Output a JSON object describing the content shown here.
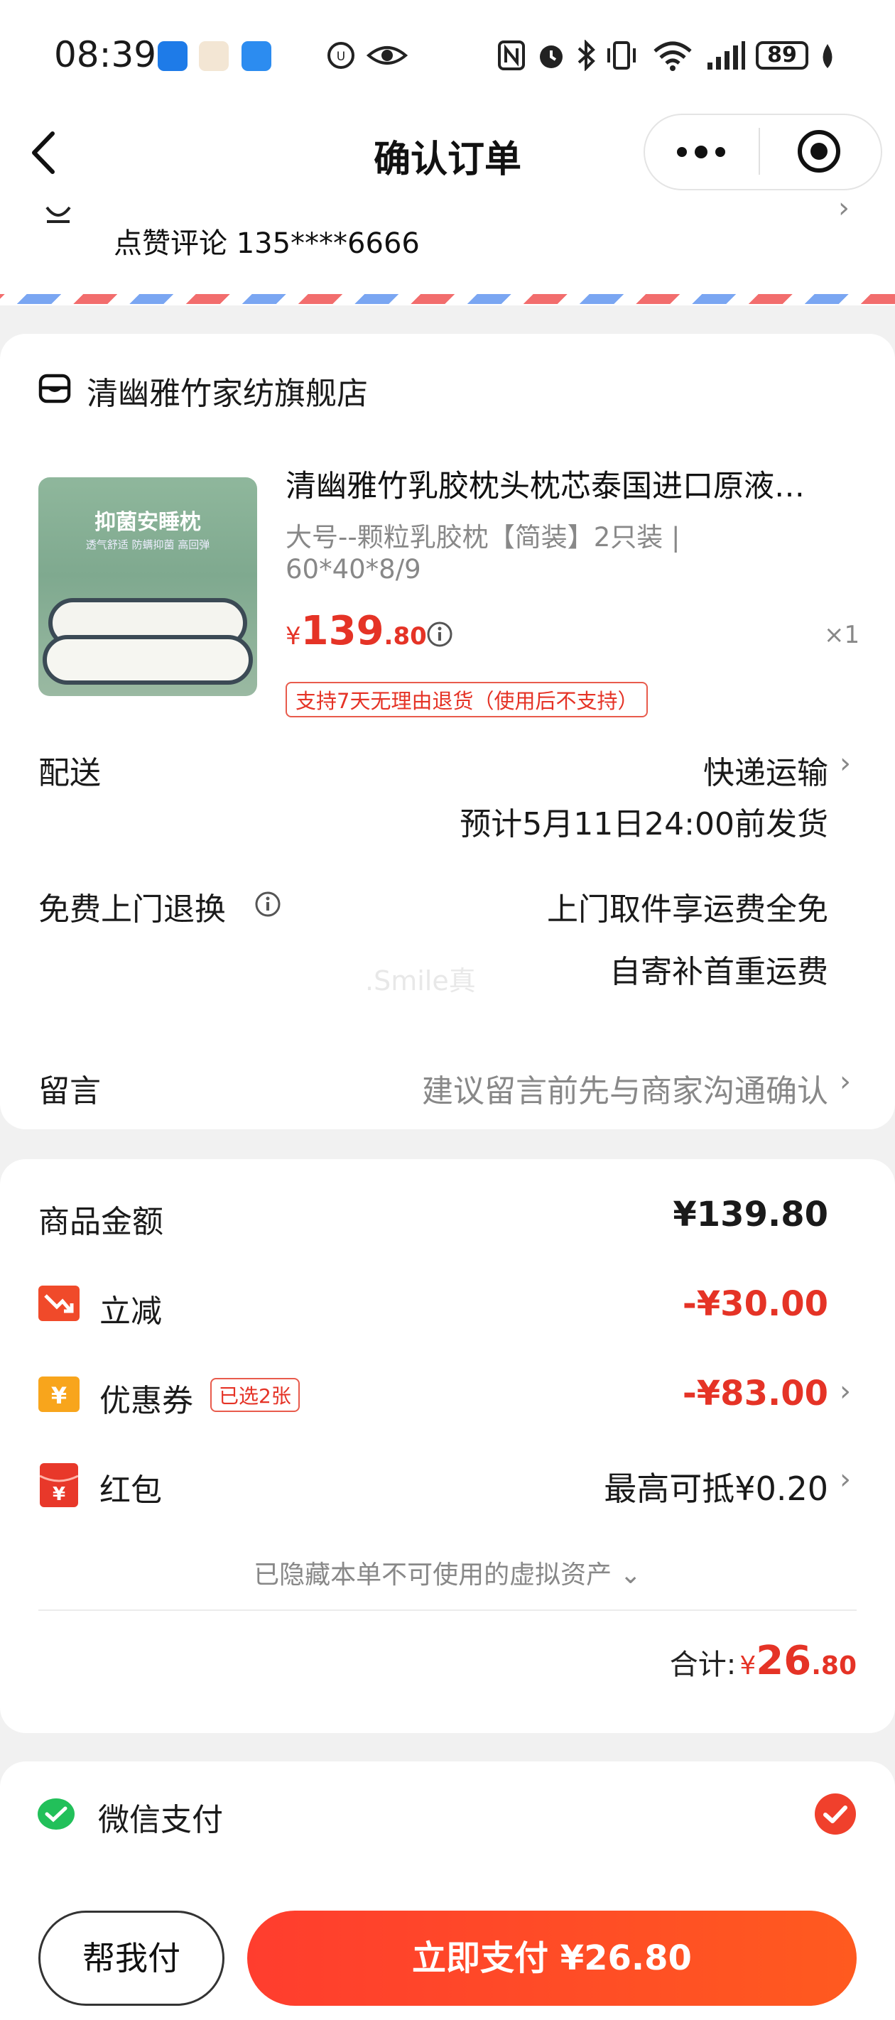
{
  "status_bar": {
    "time": "08:39",
    "battery": "89",
    "icons": [
      "app-icon-1",
      "app-icon-2",
      "app-icon-3",
      "vpn-icon",
      "eye-icon",
      "nfc-icon",
      "alarm-icon",
      "bluetooth-icon",
      "vibrate-icon",
      "wifi-icon",
      "signal-icon",
      "battery-icon",
      "leaf-icon"
    ]
  },
  "nav": {
    "title": "确认订单",
    "back_icon": "back-arrow-icon",
    "more_icon": "more-dots-icon",
    "target_icon": "target-icon"
  },
  "address": {
    "name_phone": "点赞评论 135****6666"
  },
  "shop": {
    "name": "清幽雅竹家纺旗舰店"
  },
  "product": {
    "image_text": "抑菌安睡枕",
    "image_subtext": "透气舒适 防螨抑菌 高回弹",
    "title": "清幽雅竹乳胶枕头枕芯泰国进口原液…",
    "spec_line1": "大号--颗粒乳胶枕【简装】2只装 |",
    "spec_line2": "60*40*8/9",
    "price_symbol": "¥",
    "price_int": "139",
    "price_dec": ".80",
    "quantity": "×1",
    "return_tag": "支持7天无理由退货（使用后不支持）"
  },
  "delivery": {
    "label": "配送",
    "method": "快递运输",
    "estimate": "预计5月11日24:00前发货"
  },
  "free_return": {
    "label": "免费上门退换",
    "line1": "上门取件享运费全免",
    "line2": "自寄补首重运费",
    "watermark": ".Smile真"
  },
  "message": {
    "label": "留言",
    "placeholder": "建议留言前先与商家沟通确认"
  },
  "summary": {
    "goods_label": "商品金额",
    "goods_value": "¥139.80",
    "discount_label": "立减",
    "discount_value": "-¥30.00",
    "coupon_label": "优惠券",
    "coupon_tag": "已选2张",
    "coupon_value": "-¥83.00",
    "redpacket_label": "红包",
    "redpacket_value": "最高可抵¥0.20",
    "hidden_assets": "已隐藏本单不可使用的虚拟资产",
    "total_label": "合计:",
    "total_symbol": "¥",
    "total_int": "26",
    "total_dec": ".80"
  },
  "payment": {
    "method": "微信支付"
  },
  "bottom": {
    "help_pay": "帮我付",
    "pay_now": "立即支付 ¥26.80"
  },
  "colors": {
    "accent_red": "#e53326",
    "pay_gradient_start": "#ff3d2e",
    "pay_gradient_end": "#ff5a1f",
    "wechat_green": "#22c05a"
  }
}
